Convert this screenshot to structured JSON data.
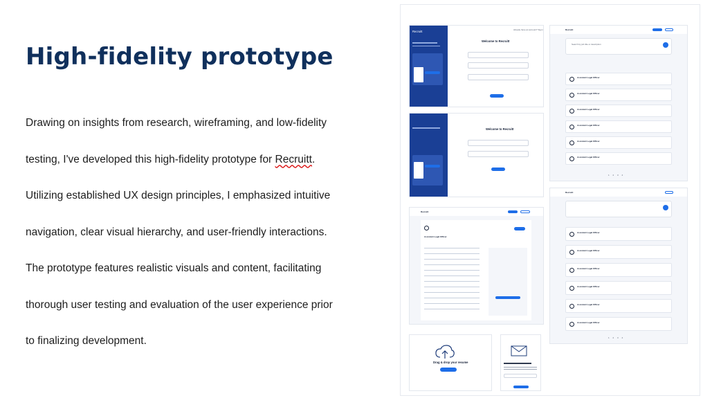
{
  "slide": {
    "title": "High-fidelity prototype",
    "paragraph_lines": [
      "Drawing on insights from research, wireframing, and low-fidelity",
      "testing, I've developed this high-fidelity prototype for",
      "Utilizing established UX design principles, I emphasized intuitive",
      "navigation, clear visual hierarchy, and user-friendly interactions.",
      "The prototype features realistic visuals and content, facilitating",
      "thorough user testing and evaluation of the user experience prior",
      "to finalizing development."
    ],
    "brand_word": "Recruitt",
    "brand_suffix": "."
  },
  "mockups": {
    "brand": "Recruitt",
    "welcome_title": "Welcome to Recruitt",
    "sign_up_label": "Sign up",
    "sign_in_label": "Sign in",
    "job_title": "Assistant Legal Officer",
    "apply_label": "Apply",
    "drag_drop_title": "Drag & drop your resume",
    "browse_files_label": "Browse files",
    "page_numbers": "1 2 3 4"
  },
  "colors": {
    "title": "#10305c",
    "accent": "#1e6ee8",
    "panel_blue": "#1a3f95",
    "squiggle": "#dd2222"
  }
}
